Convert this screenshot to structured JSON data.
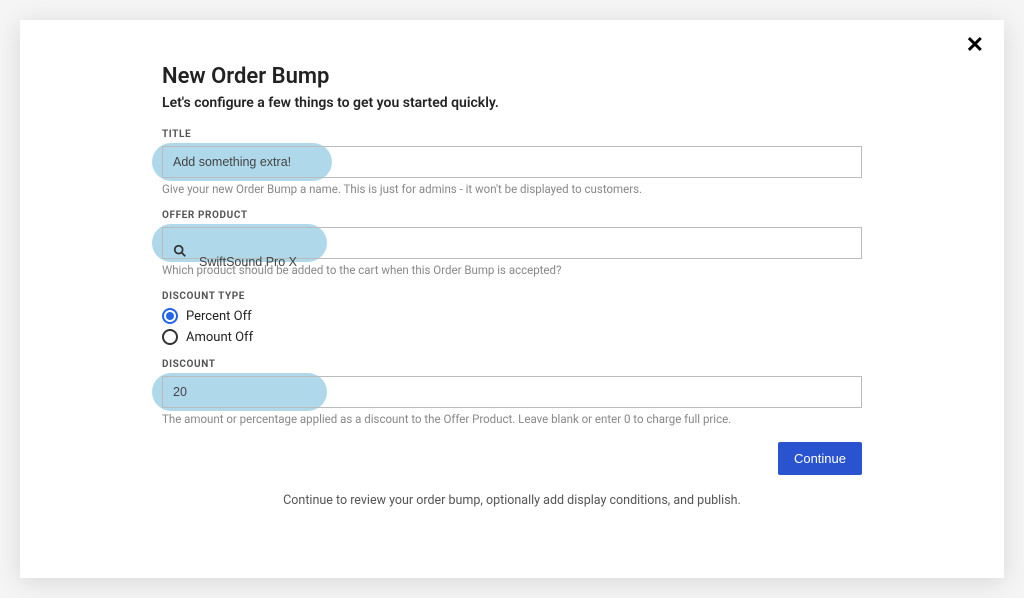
{
  "modal": {
    "heading": "New Order Bump",
    "subheading": "Let's configure a few things to get you started quickly."
  },
  "title_field": {
    "label": "TITLE",
    "value": "Add something extra!",
    "helper": "Give your new Order Bump a name. This is just for admins - it won't be displayed to customers."
  },
  "offer_product": {
    "label": "OFFER PRODUCT",
    "value": "SwiftSound Pro X",
    "helper": "Which product should be added to the cart when this Order Bump is accepted?"
  },
  "discount_type": {
    "label": "DISCOUNT TYPE",
    "options": {
      "percent": "Percent Off",
      "amount": "Amount Off"
    },
    "selected": "percent"
  },
  "discount": {
    "label": "DISCOUNT",
    "value": "20",
    "helper": "The amount or percentage applied as a discount to the Offer Product. Leave blank or enter 0 to charge full price."
  },
  "actions": {
    "continue": "Continue"
  },
  "footer": {
    "text": "Continue to review your order bump, optionally add display conditions, and publish."
  }
}
